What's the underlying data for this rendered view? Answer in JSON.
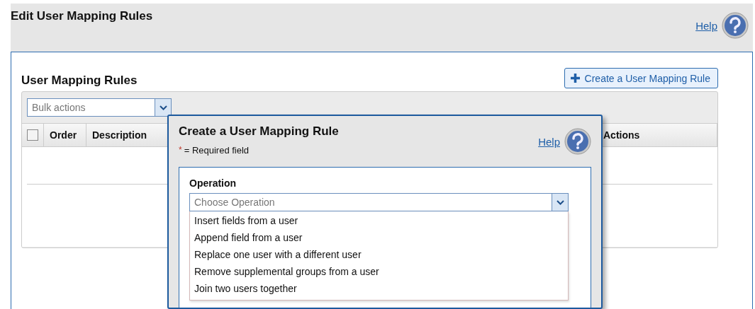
{
  "page": {
    "title": "Edit User Mapping Rules",
    "help_link": "Help"
  },
  "panel": {
    "title": "User Mapping Rules",
    "create_button": "Create a User Mapping Rule",
    "bulk_actions": {
      "placeholder": "Bulk actions"
    },
    "select_all": {
      "checked": false
    },
    "columns": [
      "Order",
      "Description",
      "Actions"
    ]
  },
  "dialog": {
    "title": "Create a User Mapping Rule",
    "required_mark": "*",
    "required_note": "= Required field",
    "help_link": "Help",
    "operation": {
      "label": "Operation",
      "placeholder": "Choose Operation",
      "options": [
        {
          "label": "Insert fields from a user",
          "selected": false
        },
        {
          "label": "Append field from a user",
          "selected": false
        },
        {
          "label": "Replace one user with a different user",
          "selected": false
        },
        {
          "label": "Remove supplemental groups from a user",
          "selected": false
        },
        {
          "label": "Join two users together",
          "selected": false
        }
      ]
    }
  }
}
